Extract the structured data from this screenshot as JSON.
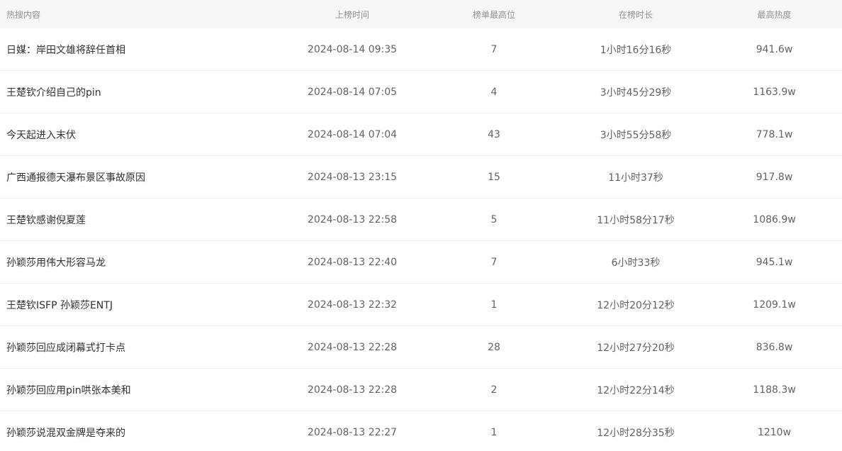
{
  "columns": {
    "content": "热搜内容",
    "time": "上榜时间",
    "rank": "榜单最高位",
    "duration": "在榜时长",
    "heat": "最高热度"
  },
  "rows": [
    {
      "title": "日媒：岸田文雄将辞任首相",
      "time": "2024-08-14 09:35",
      "rank": "7",
      "duration": "1小时16分16秒",
      "heat": "941.6w"
    },
    {
      "title": "王楚钦介绍自己的pin",
      "time": "2024-08-14 07:05",
      "rank": "4",
      "duration": "3小时45分29秒",
      "heat": "1163.9w"
    },
    {
      "title": "今天起进入末伏",
      "time": "2024-08-14 07:04",
      "rank": "43",
      "duration": "3小时55分58秒",
      "heat": "778.1w"
    },
    {
      "title": "广西通报德天瀑布景区事故原因",
      "time": "2024-08-13 23:15",
      "rank": "15",
      "duration": "11小时37秒",
      "heat": "917.8w"
    },
    {
      "title": "王楚钦感谢倪夏莲",
      "time": "2024-08-13 22:58",
      "rank": "5",
      "duration": "11小时58分17秒",
      "heat": "1086.9w"
    },
    {
      "title": "孙颖莎用伟大形容马龙",
      "time": "2024-08-13 22:40",
      "rank": "7",
      "duration": "6小时33秒",
      "heat": "945.1w"
    },
    {
      "title": "王楚钦ISFP 孙颖莎ENTJ",
      "time": "2024-08-13 22:32",
      "rank": "1",
      "duration": "12小时20分12秒",
      "heat": "1209.1w"
    },
    {
      "title": "孙颖莎回应成闭幕式打卡点",
      "time": "2024-08-13 22:28",
      "rank": "28",
      "duration": "12小时27分20秒",
      "heat": "836.8w"
    },
    {
      "title": "孙颖莎回应用pin哄张本美和",
      "time": "2024-08-13 22:28",
      "rank": "2",
      "duration": "12小时22分14秒",
      "heat": "1188.3w"
    },
    {
      "title": "孙颖莎说混双金牌是夺来的",
      "time": "2024-08-13 22:27",
      "rank": "1",
      "duration": "12小时28分35秒",
      "heat": "1210w"
    }
  ]
}
